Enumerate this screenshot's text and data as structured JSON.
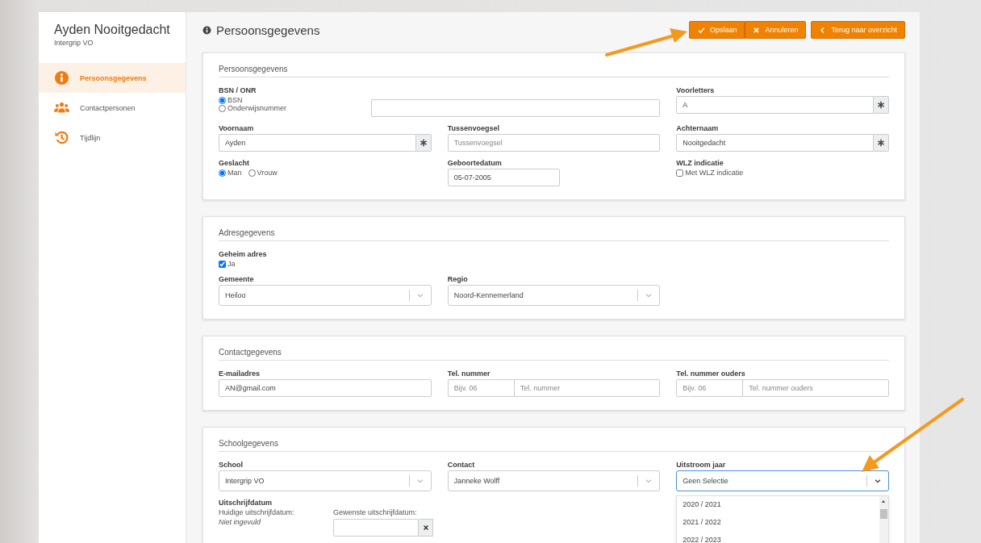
{
  "sidebar": {
    "name": "Ayden Nooitgedacht",
    "organization": "Intergrip VO",
    "items": [
      {
        "label": "Persoonsgegevens",
        "kind": "info",
        "selected": true
      },
      {
        "label": "Contactpersonen",
        "kind": "people",
        "selected": false
      },
      {
        "label": "Tijdlijn",
        "kind": "history",
        "selected": false
      }
    ]
  },
  "header": {
    "title": "Persoonsgegevens",
    "buttons": [
      {
        "label": "Opslaan",
        "kind": "save"
      },
      {
        "label": "Annuleren",
        "kind": "cancel"
      },
      {
        "label": "Terug naar overzicht",
        "kind": "back"
      }
    ]
  },
  "sections": [
    {
      "title": "Persoonsgegevens",
      "rows": [
        [
          {
            "kind": "radio-list",
            "label": "BSN / ONR",
            "options": [
              {
                "label": "BSN",
                "selected": true
              },
              {
                "label": "Onderwijsnummer",
                "selected": false
              }
            ]
          },
          {
            "kind": "text",
            "required": false
          },
          {
            "kind": "text",
            "label": "Voorletters",
            "value": "A",
            "required": true
          }
        ],
        [
          {
            "kind": "text",
            "label": "Voornaam",
            "value": "Ayden",
            "required": true
          },
          {
            "kind": "text",
            "label": "Tussenvoegsel",
            "placeholder": "Tussenvoegsel",
            "required": false
          },
          {
            "kind": "text",
            "label": "Achternaam",
            "value": "Nooitgedacht",
            "required": true
          }
        ],
        [
          {
            "kind": "radio",
            "label": "Geslacht",
            "options": [
              {
                "label": "Man",
                "selected": true
              },
              {
                "label": "Vrouw",
                "selected": false
              }
            ]
          },
          {
            "kind": "date",
            "label": "Geboortedatum",
            "value": "05-07-2005"
          },
          {
            "kind": "checkbox",
            "label": "WLZ indicatie",
            "options": [
              {
                "label": "Met WLZ indicatie",
                "checked": false
              }
            ]
          }
        ]
      ]
    },
    {
      "title": "Adresgegevens",
      "rows": [
        [
          {
            "kind": "checkbox",
            "label": "Geheim adres",
            "options": [
              {
                "label": "Ja",
                "checked": true
              }
            ]
          }
        ],
        [
          {
            "kind": "select",
            "label": "Gemeente",
            "value": "Heiloo",
            "expanded": false
          },
          {
            "kind": "select",
            "label": "Regio",
            "value": "Noord-Kennemerland",
            "expanded": false
          }
        ]
      ]
    },
    {
      "title": "Contactgegevens",
      "rows": [
        [
          {
            "kind": "text",
            "label": "E-mailadres",
            "value": "AN@gmail.com",
            "required": false
          },
          {
            "kind": "phone",
            "label": "Tel. nummer",
            "prefix_placeholder": "Bijv. 06",
            "placeholder": "Tel. nummer"
          },
          {
            "kind": "phone",
            "label": "Tel. nummer ouders",
            "prefix_placeholder": "Bijv. 06",
            "placeholder": "Tel. nummer ouders"
          }
        ]
      ]
    },
    {
      "title": "Schoolgegevens",
      "rows": [
        [
          {
            "kind": "select",
            "label": "School",
            "value": "Intergrip VO",
            "expanded": false
          },
          {
            "kind": "select",
            "label": "Contact",
            "value": "Janneke Wolff",
            "expanded": false
          },
          {
            "kind": "select",
            "label": "Uitstroom jaar",
            "value": "Geen Selectie",
            "expanded": true,
            "options": [
              "2020 / 2021",
              "2021 / 2022",
              "2022 / 2023"
            ]
          }
        ],
        [
          {
            "kind": "deregistration",
            "label": "Uitschrijfdatum",
            "current_label": "Huidige uitschrijfdatum:",
            "current_value": "Niet ingevuld",
            "desired_label": "Gewenste uitschrijfdatum:"
          }
        ]
      ]
    }
  ]
}
